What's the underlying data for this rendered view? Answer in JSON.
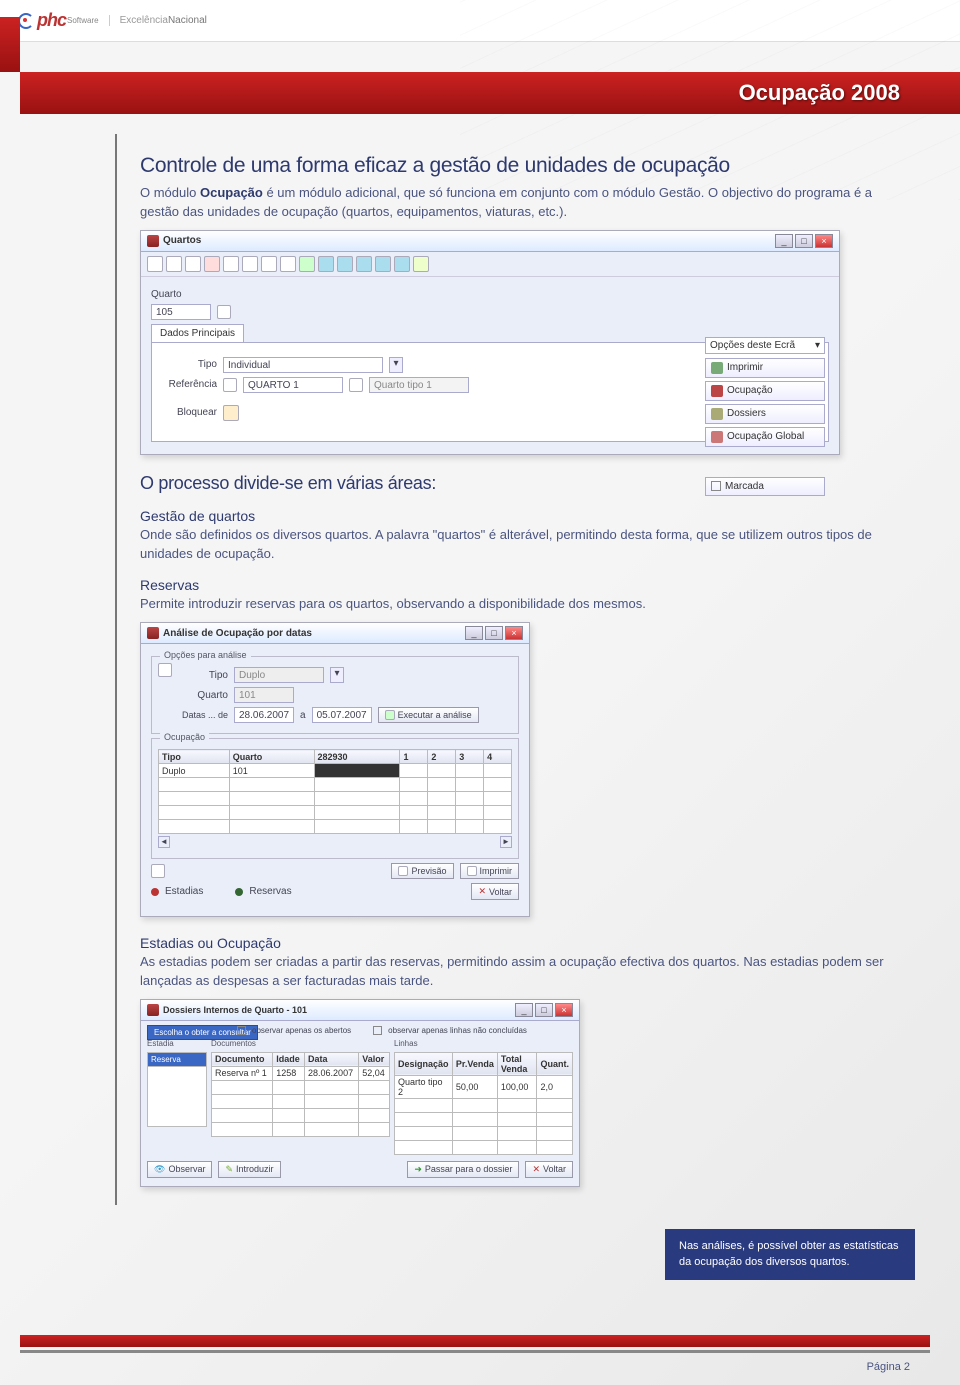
{
  "header": {
    "brand_main": "phc",
    "brand_sub": "Software",
    "tagline_light": "Excelência",
    "tagline_bold": "Nacional"
  },
  "title": "Ocupação 2008",
  "intro": {
    "heading": "Controle de uma forma eficaz a gestão de unidades de ocupação",
    "p1a": "O módulo ",
    "p1b": "Ocupação",
    "p1c": " é um módulo adicional, que só funciona em conjunto com o módulo Gestão. O objectivo do programa é a gestão das unidades de ocupação (quartos, equipamentos, viaturas, etc.)."
  },
  "shot1": {
    "win_title": "Quartos",
    "field_quarto_label": "Quarto",
    "field_quarto_value": "105",
    "tab": "Dados Principais",
    "tipo_label": "Tipo",
    "tipo_value": "Individual",
    "ref_label": "Referência",
    "ref_value": "QUARTO 1",
    "ref_hint": "Quarto tipo 1",
    "bloquear": "Bloquear",
    "right_combo": "Opções deste Ecrã",
    "opt1": "Imprimir",
    "opt2": "Ocupação",
    "opt3": "Dossiers",
    "opt4": "Ocupação Global",
    "chk": "Marcada"
  },
  "areas": {
    "heading": "O processo divide-se em várias áreas:",
    "s1_h": "Gestão de quartos",
    "s1_p": "Onde são definidos os diversos quartos. A palavra \"quartos\" é alterável, permitindo desta forma, que se utilizem outros tipos de unidades de ocupação.",
    "s2_h": "Reservas",
    "s2_p": "Permite introduzir reservas para os quartos, observando a disponibilidade dos mesmos."
  },
  "shot2": {
    "win_title": "Análise de Ocupação por datas",
    "group1": "Opções para análise",
    "tipo_label": "Tipo",
    "tipo_value": "Duplo",
    "quarto_label": "Quarto",
    "quarto_value": "101",
    "datas_label": "Datas ... de",
    "d1": "28.06.2007",
    "a": "a",
    "d2": "05.07.2007",
    "exec": "Executar a análise",
    "group2": "Ocupação",
    "col_tipo": "Tipo",
    "col_quarto": "Quarto",
    "col_n": "282930",
    "c1": "1",
    "c2": "2",
    "c3": "3",
    "c4": "4",
    "row_tipo": "Duplo",
    "row_quarto": "101",
    "btn_prev": "Previsão",
    "btn_imp": "Imprimir",
    "leg1": "Estadias",
    "leg2": "Reservas",
    "btn_voltar": "Voltar"
  },
  "areas2": {
    "s3_h": "Estadias ou Ocupação",
    "s3_p": "As estadias podem ser criadas a partir das reservas, permitindo assim a ocupação efectiva dos quartos. Nas estadias podem ser lançadas as despesas a ser facturadas mais tarde."
  },
  "shot3": {
    "win_title": "Dossiers Internos de Quarto - 101",
    "topbtn": "Escolha o obter a consultar",
    "chk1": "observar apenas os abertos",
    "chk2": "observar apenas linhas não concluídas",
    "left_h": "Estadia",
    "left_row": "Reserva",
    "mid_h": "Documentos",
    "mc1": "Documento",
    "mc2": "Idade",
    "mc3": "Data",
    "mc4": "Valor",
    "mr1": "Reserva nº 1",
    "mr2": "1258",
    "mr3": "28.06.2007",
    "mr4": "52,04",
    "right_h": "Linhas",
    "rc1": "Designação",
    "rc2": "Pr.Venda",
    "rc3": "Total Venda",
    "rc4": "Quant.",
    "rr1": "Quarto tipo 2",
    "rr2": "50,00",
    "rr3": "100,00",
    "rr4": "2,0",
    "b1": "Observar",
    "b2": "Introduzir",
    "b3": "Passar para o dossier",
    "b4": "Voltar"
  },
  "callout": "Nas análises, é possível obter as estatísticas da ocupação dos diversos quartos.",
  "footer": "Página 2"
}
